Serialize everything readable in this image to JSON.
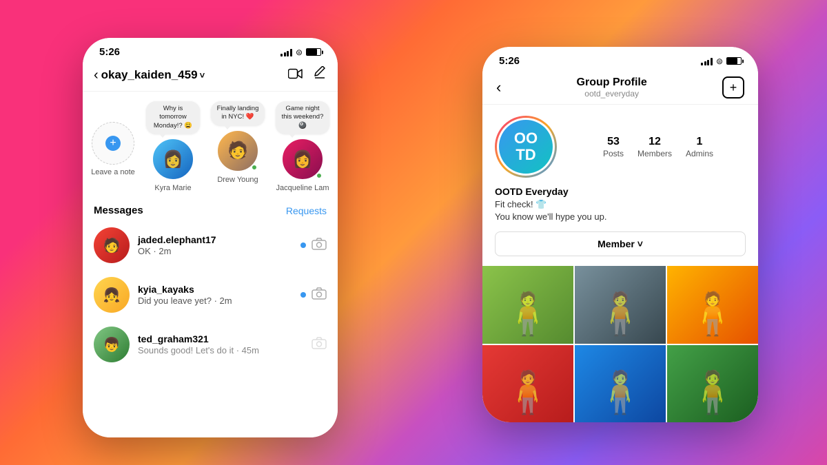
{
  "background": {
    "gradient": "linear-gradient(135deg, #f9317a 0%, #ff6b35 35%, #ff9a3c 50%, #c850c0 65%, #8b5cf6 80%)"
  },
  "left_phone": {
    "status_bar": {
      "time": "5:26"
    },
    "header": {
      "back_icon": "‹",
      "username": "okay_kaiden_459",
      "chevron": "˅",
      "video_icon": "⊡",
      "edit_icon": "✏"
    },
    "notes_row": [
      {
        "id": "leave-note",
        "label": "Leave a note",
        "type": "add",
        "bubble": null
      },
      {
        "id": "kyra-marie",
        "label": "Kyra Marie",
        "type": "user",
        "bubble": "Why is tomorrow Monday!? 😩",
        "online": false
      },
      {
        "id": "drew-young",
        "label": "Drew Young",
        "type": "user",
        "bubble": "Finally landing in NYC! ❤️",
        "online": true
      },
      {
        "id": "jacqueline-lam",
        "label": "Jacqueline Lam",
        "type": "user",
        "bubble": "Game night this weekend? 🎱",
        "online": true
      }
    ],
    "messages_header": {
      "title": "Messages",
      "requests_label": "Requests"
    },
    "messages": [
      {
        "username": "jaded.elephant17",
        "preview": "OK · 2m",
        "unread": true
      },
      {
        "username": "kyia_kayaks",
        "preview": "Did you leave yet? · 2m",
        "unread": true
      },
      {
        "username": "ted_graham321",
        "preview": "Sounds good! Let's do it · 45m",
        "unread": false
      }
    ]
  },
  "right_phone": {
    "status_bar": {
      "time": "5:26"
    },
    "header": {
      "back_icon": "‹",
      "title": "Group Profile",
      "subtitle": "ootd_everyday",
      "add_icon": "+"
    },
    "profile": {
      "avatar_text": "OO\nTD",
      "stats": [
        {
          "num": "53",
          "label": "Posts"
        },
        {
          "num": "12",
          "label": "Members"
        },
        {
          "num": "1",
          "label": "Admins"
        }
      ],
      "group_name": "OOTD Everyday",
      "bio_line1": "Fit check! 👕",
      "bio_line2": "You know we'll hype you up.",
      "member_button": "Member ˅"
    },
    "grid_photos": [
      {
        "id": "photo-1",
        "color_class": "photo-1"
      },
      {
        "id": "photo-2",
        "color_class": "photo-2"
      },
      {
        "id": "photo-3",
        "color_class": "photo-3"
      },
      {
        "id": "photo-4",
        "color_class": "photo-4"
      },
      {
        "id": "photo-5",
        "color_class": "photo-5"
      },
      {
        "id": "photo-6",
        "color_class": "photo-6"
      }
    ]
  }
}
